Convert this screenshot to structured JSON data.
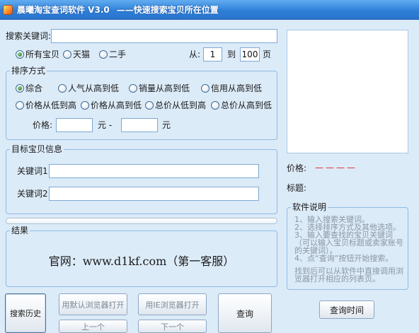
{
  "window": {
    "title": "晨曦淘宝查词软件 V3.0",
    "subtitle": "——快速搜索宝贝所在位置"
  },
  "search": {
    "label": "搜索关键词:",
    "value": ""
  },
  "scope": {
    "options": [
      {
        "label": "所有宝贝",
        "selected": true
      },
      {
        "label": "天猫",
        "selected": false
      },
      {
        "label": "二手",
        "selected": false
      }
    ]
  },
  "pages": {
    "from_label": "从:",
    "from_value": "1",
    "to_label": "到",
    "to_value": "100",
    "unit": "页"
  },
  "sort": {
    "title": "排序方式",
    "options": [
      {
        "label": "综合",
        "selected": true
      },
      {
        "label": "人气从高到低",
        "selected": false
      },
      {
        "label": "销量从高到低",
        "selected": false
      },
      {
        "label": "信用从高到低",
        "selected": false
      },
      {
        "label": "价格从低到高",
        "selected": false
      },
      {
        "label": "价格从高到低",
        "selected": false
      },
      {
        "label": "总价从低到高",
        "selected": false
      },
      {
        "label": "总价从高到低",
        "selected": false
      }
    ],
    "price_label": "价格:",
    "min_value": "",
    "separator": "元 -",
    "max_value": "",
    "unit": "元"
  },
  "target": {
    "title": "目标宝贝信息",
    "kw1_label": "关键词1:",
    "kw1_value": "",
    "kw2_label": "关键词2:",
    "kw2_value": ""
  },
  "progress": {
    "value": 0
  },
  "result": {
    "title": "结果",
    "text": "官网：www.d1kf.com（第一客服）"
  },
  "buttons": {
    "history": "搜索历史",
    "open_default": "用默认浏览器打开",
    "open_ie": "用IE浏览器打开",
    "prev": "上一个",
    "next": "下一个",
    "query": "查询",
    "query_time": "查询时间"
  },
  "detail": {
    "price_label": "价格:",
    "price_value": "————",
    "title_label": "标题:",
    "title_value": ""
  },
  "help": {
    "title": "软件说明",
    "steps": [
      "1、输入搜索关键词。",
      "2、选择排序方式及其他选项。",
      "3、输入要查找的宝贝关键词（可以输入宝贝标题或卖家账号的关键词）。",
      "4、点“查询”按钮开始搜索。"
    ],
    "note": "找到后可以从软件中直接调用浏览器打开相应的列表页。"
  },
  "colors": {
    "background": "#dcebf8",
    "title_bar": "#2f80d8",
    "price_dash": "#e02424"
  }
}
